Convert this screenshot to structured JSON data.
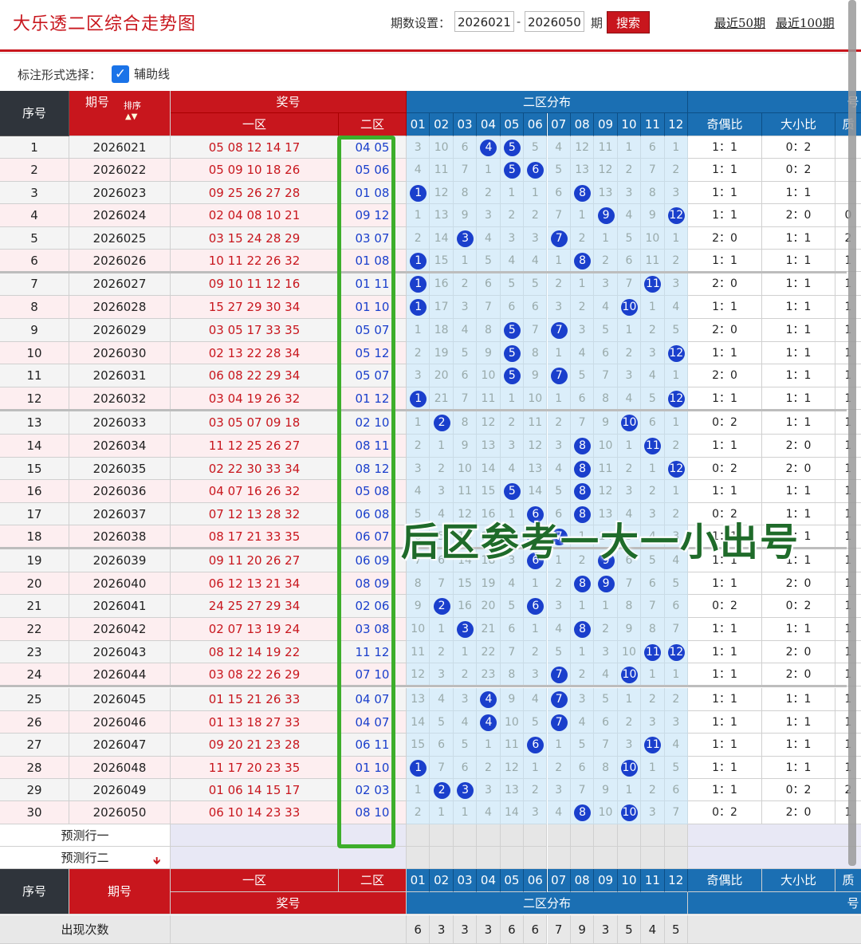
{
  "title": "大乐透二区综合走势图",
  "period_setting_label": "期数设置：",
  "period_from": "2026021",
  "period_dash": "-",
  "period_to": "2026050",
  "period_unit": "期",
  "search_label": "搜索",
  "recent50": "最近50期",
  "recent100": "最近100期",
  "mark_label": "标注形式选择：",
  "aux_line_checked": true,
  "aux_line_label": "辅助线",
  "header": {
    "seq": "序号",
    "period": "期号",
    "sort": "排序",
    "prize": "奖号",
    "zone1": "一区",
    "zone2": "二区",
    "dist": "二区分布",
    "nums": [
      "01",
      "02",
      "03",
      "04",
      "05",
      "06",
      "07",
      "08",
      "09",
      "10",
      "11",
      "12"
    ],
    "odd_even": "奇偶比",
    "big_small": "大小比",
    "extra": "号",
    "extra2": "质"
  },
  "overlay_text": "后区参考一大一小出号",
  "rows": [
    {
      "seq": "1",
      "period": "2026021",
      "front": "05 08 12 14 17",
      "back": "04 05",
      "dist": [
        "3",
        "10",
        "6",
        "04",
        "05",
        "5",
        "4",
        "12",
        "11",
        "1",
        "6",
        "1"
      ],
      "oe": "1：1",
      "bs": "0：2",
      "extra": ""
    },
    {
      "seq": "2",
      "period": "2026022",
      "front": "05 09 10 18 26",
      "back": "05 06",
      "dist": [
        "4",
        "11",
        "7",
        "1",
        "05",
        "06",
        "5",
        "13",
        "12",
        "2",
        "7",
        "2"
      ],
      "oe": "1：1",
      "bs": "0：2",
      "extra": ""
    },
    {
      "seq": "3",
      "period": "2026023",
      "front": "09 25 26 27 28",
      "back": "01 08",
      "dist": [
        "01",
        "12",
        "8",
        "2",
        "1",
        "1",
        "6",
        "08",
        "13",
        "3",
        "8",
        "3"
      ],
      "oe": "1：1",
      "bs": "1：1",
      "extra": ""
    },
    {
      "seq": "4",
      "period": "2026024",
      "front": "02 04 08 10 21",
      "back": "09 12",
      "dist": [
        "1",
        "13",
        "9",
        "3",
        "2",
        "2",
        "7",
        "1",
        "09",
        "4",
        "9",
        "12"
      ],
      "oe": "1：1",
      "bs": "2：0",
      "extra": "0"
    },
    {
      "seq": "5",
      "period": "2026025",
      "front": "03 15 24 28 29",
      "back": "03 07",
      "dist": [
        "2",
        "14",
        "03",
        "4",
        "3",
        "3",
        "07",
        "2",
        "1",
        "5",
        "10",
        "1"
      ],
      "oe": "2：0",
      "bs": "1：1",
      "extra": "2"
    },
    {
      "seq": "6",
      "period": "2026026",
      "front": "10 11 22 26 32",
      "back": "01 08",
      "dist": [
        "01",
        "15",
        "1",
        "5",
        "4",
        "4",
        "1",
        "08",
        "2",
        "6",
        "11",
        "2"
      ],
      "oe": "1：1",
      "bs": "1：1",
      "extra": "1"
    },
    {
      "seq": "7",
      "period": "2026027",
      "front": "09 10 11 12 16",
      "back": "01 11",
      "dist": [
        "01",
        "16",
        "2",
        "6",
        "5",
        "5",
        "2",
        "1",
        "3",
        "7",
        "11",
        "3"
      ],
      "oe": "2：0",
      "bs": "1：1",
      "extra": "1"
    },
    {
      "seq": "8",
      "period": "2026028",
      "front": "15 27 29 30 34",
      "back": "01 10",
      "dist": [
        "01",
        "17",
        "3",
        "7",
        "6",
        "6",
        "3",
        "2",
        "4",
        "10",
        "1",
        "4"
      ],
      "oe": "1：1",
      "bs": "1：1",
      "extra": "1"
    },
    {
      "seq": "9",
      "period": "2026029",
      "front": "03 05 17 33 35",
      "back": "05 07",
      "dist": [
        "1",
        "18",
        "4",
        "8",
        "05",
        "7",
        "07",
        "3",
        "5",
        "1",
        "2",
        "5"
      ],
      "oe": "2：0",
      "bs": "1：1",
      "extra": "1"
    },
    {
      "seq": "10",
      "period": "2026030",
      "front": "02 13 22 28 34",
      "back": "05 12",
      "dist": [
        "2",
        "19",
        "5",
        "9",
        "05",
        "8",
        "1",
        "4",
        "6",
        "2",
        "3",
        "12"
      ],
      "oe": "1：1",
      "bs": "1：1",
      "extra": "1"
    },
    {
      "seq": "11",
      "period": "2026031",
      "front": "06 08 22 29 34",
      "back": "05 07",
      "dist": [
        "3",
        "20",
        "6",
        "10",
        "05",
        "9",
        "07",
        "5",
        "7",
        "3",
        "4",
        "1"
      ],
      "oe": "2：0",
      "bs": "1：1",
      "extra": "1"
    },
    {
      "seq": "12",
      "period": "2026032",
      "front": "03 04 19 26 32",
      "back": "01 12",
      "dist": [
        "01",
        "21",
        "7",
        "11",
        "1",
        "10",
        "1",
        "6",
        "8",
        "4",
        "5",
        "12"
      ],
      "oe": "1：1",
      "bs": "1：1",
      "extra": "1"
    },
    {
      "seq": "13",
      "period": "2026033",
      "front": "03 05 07 09 18",
      "back": "02 10",
      "dist": [
        "1",
        "02",
        "8",
        "12",
        "2",
        "11",
        "2",
        "7",
        "9",
        "10",
        "6",
        "1"
      ],
      "oe": "0：2",
      "bs": "1：1",
      "extra": "1"
    },
    {
      "seq": "14",
      "period": "2026034",
      "front": "11 12 25 26 27",
      "back": "08 11",
      "dist": [
        "2",
        "1",
        "9",
        "13",
        "3",
        "12",
        "3",
        "08",
        "10",
        "1",
        "11",
        "2"
      ],
      "oe": "1：1",
      "bs": "2：0",
      "extra": "1"
    },
    {
      "seq": "15",
      "period": "2026035",
      "front": "02 22 30 33 34",
      "back": "08 12",
      "dist": [
        "3",
        "2",
        "10",
        "14",
        "4",
        "13",
        "4",
        "08",
        "11",
        "2",
        "1",
        "12"
      ],
      "oe": "0：2",
      "bs": "2：0",
      "extra": "1"
    },
    {
      "seq": "16",
      "period": "2026036",
      "front": "04 07 16 26 32",
      "back": "05 08",
      "dist": [
        "4",
        "3",
        "11",
        "15",
        "05",
        "14",
        "5",
        "08",
        "12",
        "3",
        "2",
        "1"
      ],
      "oe": "1：1",
      "bs": "1：1",
      "extra": "1"
    },
    {
      "seq": "17",
      "period": "2026037",
      "front": "07 12 13 28 32",
      "back": "06 08",
      "dist": [
        "5",
        "4",
        "12",
        "16",
        "1",
        "06",
        "6",
        "08",
        "13",
        "4",
        "3",
        "2"
      ],
      "oe": "0：2",
      "bs": "1：1",
      "extra": "1"
    },
    {
      "seq": "18",
      "period": "2026038",
      "front": "08 17 21 33 35",
      "back": "06 07",
      "dist": [
        "6",
        "5",
        "13",
        "17",
        "2",
        "06",
        "07",
        "1",
        "14",
        "5",
        "4",
        "3"
      ],
      "oe": "1：1",
      "bs": "1：1",
      "extra": "1"
    },
    {
      "seq": "19",
      "period": "2026039",
      "front": "09 11 20 26 27",
      "back": "06 09",
      "dist": [
        "7",
        "6",
        "14",
        "18",
        "3",
        "06",
        "1",
        "2",
        "09",
        "6",
        "5",
        "4"
      ],
      "oe": "1：1",
      "bs": "1：1",
      "extra": "1"
    },
    {
      "seq": "20",
      "period": "2026040",
      "front": "06 12 13 21 34",
      "back": "08 09",
      "dist": [
        "8",
        "7",
        "15",
        "19",
        "4",
        "1",
        "2",
        "08",
        "09",
        "7",
        "6",
        "5"
      ],
      "oe": "1：1",
      "bs": "2：0",
      "extra": "1"
    },
    {
      "seq": "21",
      "period": "2026041",
      "front": "24 25 27 29 34",
      "back": "02 06",
      "dist": [
        "9",
        "02",
        "16",
        "20",
        "5",
        "06",
        "3",
        "1",
        "1",
        "8",
        "7",
        "6"
      ],
      "oe": "0：2",
      "bs": "0：2",
      "extra": "1"
    },
    {
      "seq": "22",
      "period": "2026042",
      "front": "02 07 13 19 24",
      "back": "03 08",
      "dist": [
        "10",
        "1",
        "03",
        "21",
        "6",
        "1",
        "4",
        "08",
        "2",
        "9",
        "8",
        "7"
      ],
      "oe": "1：1",
      "bs": "1：1",
      "extra": "1"
    },
    {
      "seq": "23",
      "period": "2026043",
      "front": "08 12 14 19 22",
      "back": "11 12",
      "dist": [
        "11",
        "2",
        "1",
        "22",
        "7",
        "2",
        "5",
        "1",
        "3",
        "10",
        "11",
        "12"
      ],
      "oe": "1：1",
      "bs": "2：0",
      "extra": "1"
    },
    {
      "seq": "24",
      "period": "2026044",
      "front": "03 08 22 26 29",
      "back": "07 10",
      "dist": [
        "12",
        "3",
        "2",
        "23",
        "8",
        "3",
        "07",
        "2",
        "4",
        "10",
        "1",
        "1"
      ],
      "oe": "1：1",
      "bs": "2：0",
      "extra": "1"
    },
    {
      "seq": "25",
      "period": "2026045",
      "front": "01 15 21 26 33",
      "back": "04 07",
      "dist": [
        "13",
        "4",
        "3",
        "04",
        "9",
        "4",
        "07",
        "3",
        "5",
        "1",
        "2",
        "2"
      ],
      "oe": "1：1",
      "bs": "1：1",
      "extra": "1"
    },
    {
      "seq": "26",
      "period": "2026046",
      "front": "01 13 18 27 33",
      "back": "04 07",
      "dist": [
        "14",
        "5",
        "4",
        "04",
        "10",
        "5",
        "07",
        "4",
        "6",
        "2",
        "3",
        "3"
      ],
      "oe": "1：1",
      "bs": "1：1",
      "extra": "1"
    },
    {
      "seq": "27",
      "period": "2026047",
      "front": "09 20 21 23 28",
      "back": "06 11",
      "dist": [
        "15",
        "6",
        "5",
        "1",
        "11",
        "06",
        "1",
        "5",
        "7",
        "3",
        "11",
        "4"
      ],
      "oe": "1：1",
      "bs": "1：1",
      "extra": "1"
    },
    {
      "seq": "28",
      "period": "2026048",
      "front": "11 17 20 23 35",
      "back": "01 10",
      "dist": [
        "01",
        "7",
        "6",
        "2",
        "12",
        "1",
        "2",
        "6",
        "8",
        "10",
        "1",
        "5"
      ],
      "oe": "1：1",
      "bs": "1：1",
      "extra": "1"
    },
    {
      "seq": "29",
      "period": "2026049",
      "front": "01 06 14 15 17",
      "back": "02 03",
      "dist": [
        "1",
        "02",
        "03",
        "3",
        "13",
        "2",
        "3",
        "7",
        "9",
        "1",
        "2",
        "6"
      ],
      "oe": "1：1",
      "bs": "0：2",
      "extra": "2"
    },
    {
      "seq": "30",
      "period": "2026050",
      "front": "06 10 14 23 33",
      "back": "08 10",
      "dist": [
        "2",
        "1",
        "1",
        "4",
        "14",
        "3",
        "4",
        "08",
        "10",
        "10",
        "3",
        "7"
      ],
      "oe": "0：2",
      "bs": "2：0",
      "extra": "1"
    }
  ],
  "predict1": "预测行一",
  "predict2": "预测行二",
  "footer": {
    "seq": "序号",
    "period": "期号",
    "zone1": "一区",
    "zone2": "二区",
    "prize": "奖号",
    "dist": "二区分布",
    "oe": "奇偶比",
    "bs": "大小比",
    "extra": "号",
    "extra2": "质"
  },
  "occurrence_label": "出现次数",
  "occurrences": [
    "6",
    "3",
    "3",
    "3",
    "6",
    "6",
    "7",
    "9",
    "3",
    "5",
    "4",
    "5"
  ]
}
